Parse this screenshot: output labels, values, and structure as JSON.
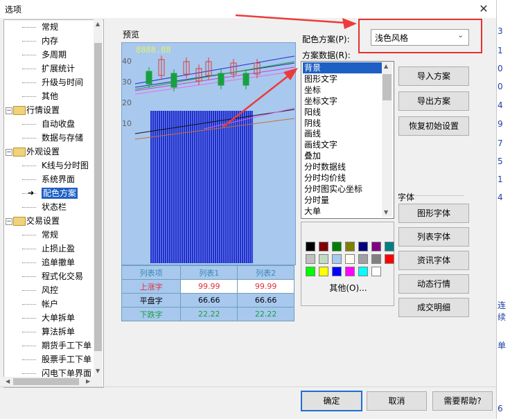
{
  "window": {
    "title": "选项",
    "close": "✕"
  },
  "right_strip": [
    "3",
    "1",
    "0",
    "0",
    "4",
    "9",
    "7",
    "5",
    "1",
    "4",
    "连续",
    "单",
    "6"
  ],
  "tree": {
    "items": [
      {
        "label": "常规",
        "level": 1
      },
      {
        "label": "内存",
        "level": 1
      },
      {
        "label": "多周期",
        "level": 1
      },
      {
        "label": "扩展统计",
        "level": 1
      },
      {
        "label": "升级与时间",
        "level": 1
      },
      {
        "label": "其他",
        "level": 1
      },
      {
        "label": "行情设置",
        "level": 0
      },
      {
        "label": "自动收盘",
        "level": 1
      },
      {
        "label": "数据与存储",
        "level": 1
      },
      {
        "label": "外观设置",
        "level": 0
      },
      {
        "label": "K线与分时图",
        "level": 1
      },
      {
        "label": "系统界面",
        "level": 1
      },
      {
        "label": "配色方案",
        "level": 1,
        "selected": true
      },
      {
        "label": "状态栏",
        "level": 1
      },
      {
        "label": "交易设置",
        "level": 0
      },
      {
        "label": "常规",
        "level": 1
      },
      {
        "label": "止损止盈",
        "level": 1
      },
      {
        "label": "追单撤单",
        "level": 1
      },
      {
        "label": "程式化交易",
        "level": 1
      },
      {
        "label": "风控",
        "level": 1
      },
      {
        "label": "帐户",
        "level": 1
      },
      {
        "label": "大单拆单",
        "level": 1
      },
      {
        "label": "算法拆单",
        "level": 1
      },
      {
        "label": "期货手工下单",
        "level": 1
      },
      {
        "label": "股票手工下单",
        "level": 1
      },
      {
        "label": "闪电下单界面",
        "level": 1
      }
    ]
  },
  "preview": {
    "label": "预览",
    "digits": "8888.88",
    "y_ticks": [
      "40",
      "30",
      "20",
      "10"
    ],
    "table": {
      "header": [
        "列表项",
        "列表1",
        "列表2"
      ],
      "rows": [
        {
          "label": "上涨字",
          "v1": "99.99",
          "v2": "99.99",
          "color": "#e0303a"
        },
        {
          "label": "平盘字",
          "v1": "66.66",
          "v2": "66.66",
          "color": "#000000"
        },
        {
          "label": "下跌字",
          "v1": "22.22",
          "v2": "22.22",
          "color": "#18a040"
        }
      ]
    }
  },
  "scheme": {
    "label": "配色方案(P):",
    "value": "浅色风格"
  },
  "scheme_data": {
    "label": "方案数据(R):",
    "items": [
      "背景",
      "图形文字",
      "坐标",
      "坐标文字",
      "阳线",
      "阴线",
      "画线",
      "画线文字",
      "叠加",
      "分时数据线",
      "分时均价线",
      "分时图实心坐标",
      "分时量",
      "大单"
    ],
    "selected": 0
  },
  "palette": {
    "colors": [
      "#000000",
      "#800000",
      "#008000",
      "#808000",
      "#000080",
      "#800080",
      "#008080",
      "#c0c0c0",
      "#c0dcc0",
      "#a6caf0",
      "#fffbf0",
      "#a0a0a4",
      "#808080",
      "#ff0000",
      "#00ff00",
      "#ffff00",
      "#0000ff",
      "#ff00ff",
      "#00ffff",
      "#ffffff"
    ],
    "other": "其他(O)..."
  },
  "buttons": {
    "import": "导入方案",
    "export": "导出方案",
    "restore": "恢复初始设置",
    "font_header": "字体",
    "graph_font": "图形字体",
    "list_font": "列表字体",
    "info_font": "资讯字体",
    "dynamic_quote": "动态行情",
    "trade_detail": "成交明细"
  },
  "footer": {
    "ok": "确定",
    "cancel": "取消",
    "help": "需要帮助?"
  }
}
